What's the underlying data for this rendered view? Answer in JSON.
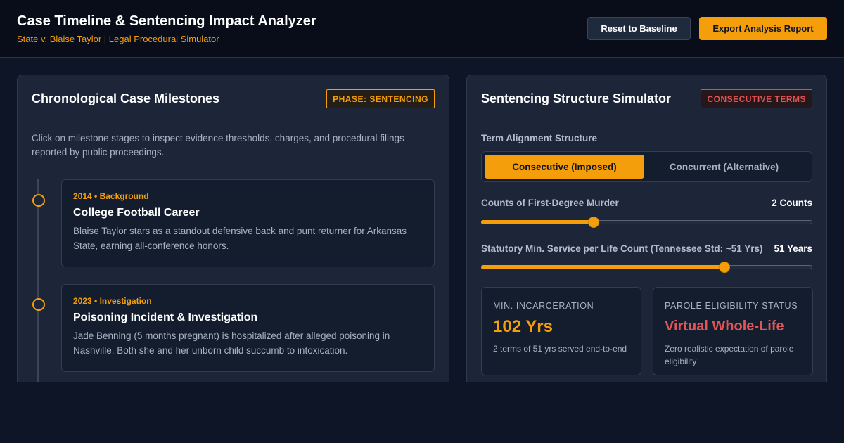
{
  "header": {
    "title": "Case Timeline & Sentencing Impact Analyzer",
    "subtitle": "State v. Blaise Taylor | Legal Procedural Simulator",
    "reset_label": "Reset to Baseline",
    "export_label": "Export Analysis Report"
  },
  "milestones": {
    "title": "Chronological Case Milestones",
    "phase_badge": "PHASE: SENTENCING",
    "intro": "Click on milestone stages to inspect evidence thresholds, charges, and procedural filings reported by public proceedings.",
    "items": [
      {
        "meta": "2014 • Background",
        "title": "College Football Career",
        "description": "Blaise Taylor stars as a standout defensive back and punt returner for Arkansas State, earning all-conference honors."
      },
      {
        "meta": "2023 • Investigation",
        "title": "Poisoning Incident & Investigation",
        "description": "Jade Benning (5 months pregnant) is hospitalized after alleged poisoning in Nashville. Both she and her unborn child succumb to intoxication."
      }
    ]
  },
  "simulator": {
    "title": "Sentencing Structure Simulator",
    "term_badge": "CONSECUTIVE TERMS",
    "alignment_label": "Term Alignment Structure",
    "options": {
      "consecutive": "Consecutive (Imposed)",
      "concurrent": "Concurrent (Alternative)"
    },
    "counts": {
      "label": "Counts of First-Degree Murder",
      "display": "2 Counts",
      "slider_fraction": 0.34
    },
    "min_service": {
      "label": "Statutory Min. Service per Life Count (Tennessee Std: ~51 Yrs)",
      "display": "51 Years",
      "slider_fraction": 0.735
    },
    "stats": {
      "incarceration": {
        "label": "MIN. INCARCERATION",
        "value": "102 Yrs",
        "note": "2 terms of 51 yrs served end-to-end"
      },
      "parole": {
        "label": "PAROLE ELIGIBILITY STATUS",
        "value": "Virtual Whole-Life",
        "note": "Zero realistic expectation of parole eligibility"
      }
    }
  },
  "colors": {
    "accent": "#f59e0b",
    "danger": "#e05555",
    "background": "#0d1527",
    "panel": "#1c2638"
  }
}
